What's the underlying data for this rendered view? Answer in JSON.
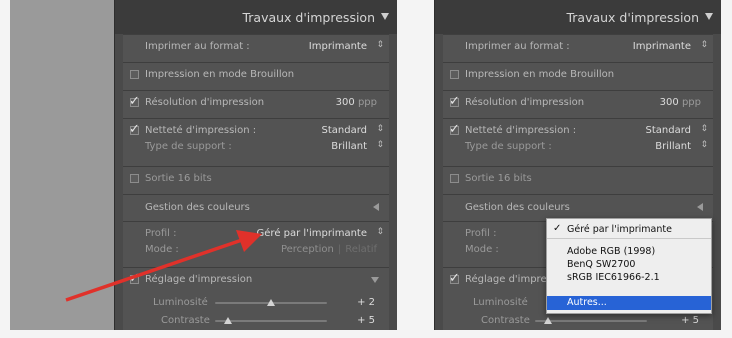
{
  "panel_title": "Travaux d'impression",
  "rows": {
    "print_format_label": "Imprimer au format :",
    "print_format_value": "Imprimante",
    "draft_mode": "Impression en mode Brouillon",
    "resolution_label": "Résolution d'impression",
    "resolution_value": "300",
    "resolution_unit": "ppp",
    "sharpening_label": "Netteté d'impression :",
    "sharpening_value": "Standard",
    "media_label": "Type de support :",
    "media_value": "Brillant",
    "bits16": "Sortie 16 bits",
    "color_mgmt": "Gestion des couleurs",
    "profile_label": "Profil :",
    "profile_value": "Géré par l'imprimante",
    "mode_label": "Mode :",
    "mode_perception": "Perception",
    "mode_sep": "|",
    "mode_relative": "Relatif",
    "print_adjust": "Réglage d'impression",
    "print_adjust_truncated": "Réglage d'impre",
    "brightness_label": "Luminosité",
    "brightness_value": "+ 2",
    "contrast_label": "Contraste",
    "contrast_value": "+ 5"
  },
  "sliders": {
    "brightness_level": 0.5,
    "contrast_level": 0.12
  },
  "profile_menu": {
    "items": [
      {
        "label": "Géré par l'imprimante",
        "checked": true
      },
      {
        "label": "Adobe RGB (1998)",
        "checked": false
      },
      {
        "label": "BenQ SW2700",
        "checked": false
      },
      {
        "label": "sRGB IEC61966-2.1",
        "checked": false
      },
      {
        "label": "Autres...",
        "checked": false,
        "highlighted": true
      }
    ]
  },
  "icons": {
    "arrow": "red-arrow-annotation",
    "collapse": "triangle-down-icon",
    "section_closed": "triangle-left-icon"
  },
  "colors": {
    "arrow": "#e0312a",
    "highlight": "#2763d6",
    "panel": "#4a4a4a"
  }
}
